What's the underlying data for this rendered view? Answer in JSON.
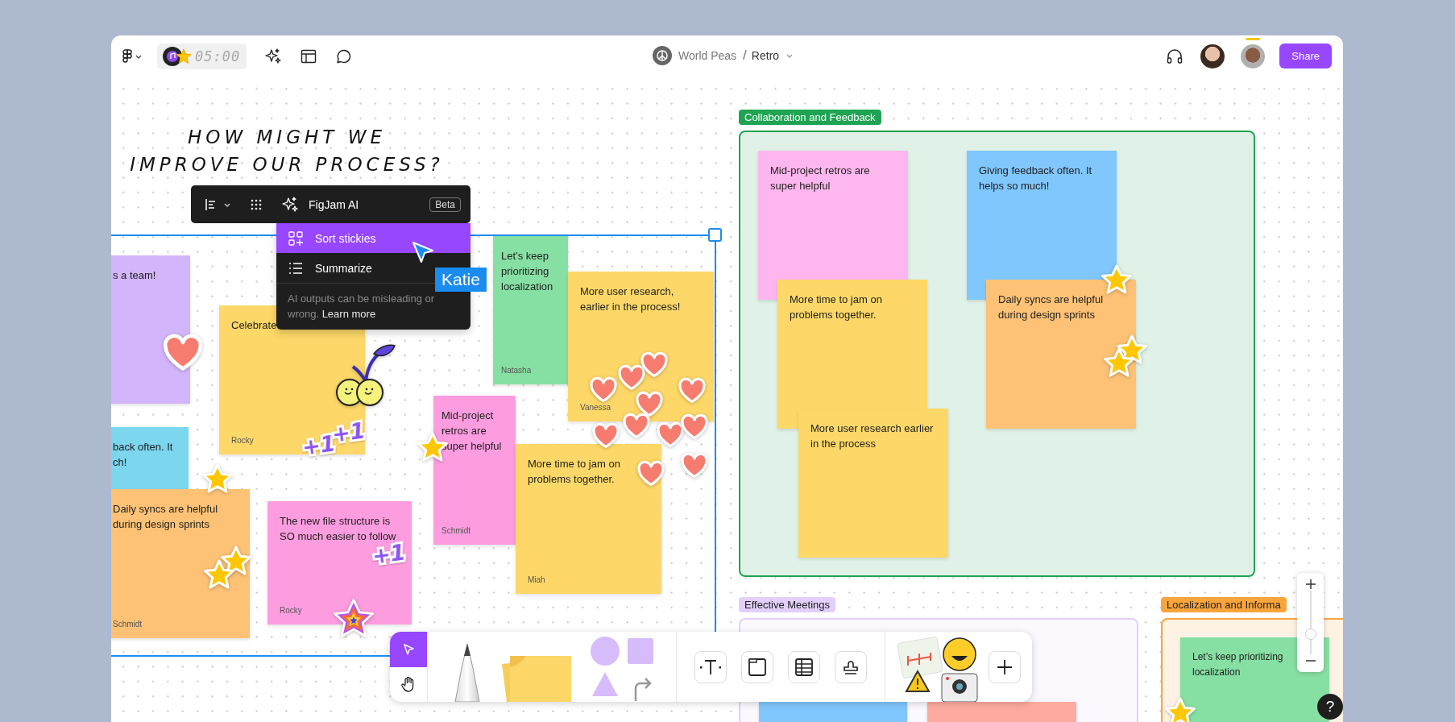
{
  "topbar": {
    "timer": "05:00",
    "team": "World Peas",
    "separator": "/",
    "file": "Retro",
    "share": "Share"
  },
  "heading": [
    "HOW MIGHT WE",
    "IMPROVE OUR PROCESS?"
  ],
  "ai_menu": {
    "title": "FigJam AI",
    "badge": "Beta",
    "items": [
      {
        "label": "Sort stickies",
        "selected": true
      },
      {
        "label": "Summarize",
        "selected": false
      }
    ],
    "note": "AI outputs can be misleading or wrong.",
    "link": "Learn more"
  },
  "cursor": {
    "name": "Katie"
  },
  "stickies": [
    {
      "text": "s a team!",
      "color": "#d3b5fb"
    },
    {
      "text": "back often. It\nch!",
      "color": "#7bd6ee"
    },
    {
      "text": "Daily syncs are helpful during design sprints",
      "author": "Schmidt",
      "color": "#fdc275"
    },
    {
      "text": "Celebrate",
      "author": "Rocky",
      "color": "#fdd868"
    },
    {
      "text": "The new file structure is SO much easier to follow",
      "author": "Rocky",
      "color": "#fd9de0"
    },
    {
      "text": "Let’s keep prioritizing localization",
      "author": "Natasha",
      "color": "#87e0a3"
    },
    {
      "text": "More user research, earlier in the process!",
      "author": "Vanessa",
      "color": "#fdd868"
    },
    {
      "text": "Mid-project retros are super helpful",
      "author": "Schmidt",
      "color": "#fd9de0"
    },
    {
      "text": "More time to jam on problems together.",
      "author": "Miah",
      "color": "#fdd868"
    }
  ],
  "plus_one_stickers": [
    "+1",
    "+1",
    "+1"
  ],
  "sections": [
    {
      "title": "Collaboration and Feedback",
      "color": "#1ea452",
      "stickies": [
        {
          "text": "Mid-project retros are super helpful",
          "color": "#fdb6ee"
        },
        {
          "text": "Giving feedback often. It helps so much!",
          "color": "#80c7fd"
        },
        {
          "text": "More time to jam on problems together.",
          "color": "#fdd868"
        },
        {
          "text": "Daily syncs are helpful during design sprints",
          "color": "#fdc275"
        },
        {
          "text": "More user research earlier in the process",
          "color": "#fdd868"
        }
      ]
    },
    {
      "title": "Effective Meetings",
      "color": "#e2cffb",
      "stickies": [
        {
          "color": "#80c7fd"
        },
        {
          "color": "#fdaba0"
        }
      ]
    },
    {
      "title": "Localization and Informa",
      "color": "#f9a53c",
      "stickies": [
        {
          "text": "Let’s keep prioritizing localization",
          "color": "#87e0a3"
        }
      ]
    }
  ],
  "zoom": {
    "level": 0.32
  },
  "help": "?"
}
